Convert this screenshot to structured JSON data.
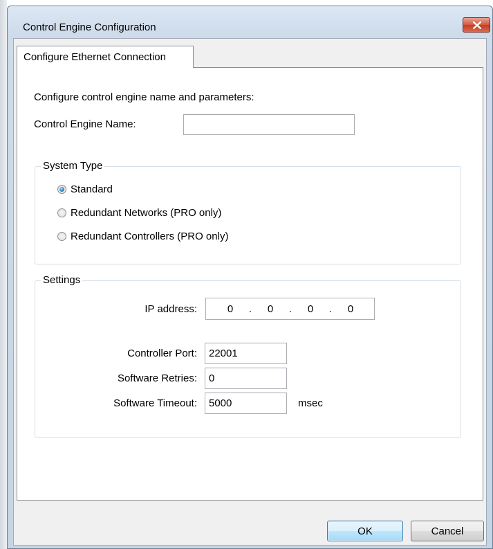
{
  "window": {
    "title": "Control Engine Configuration",
    "close_icon": "close-icon"
  },
  "tabs": [
    {
      "label": "Configure Ethernet Connection",
      "selected": true
    }
  ],
  "main": {
    "intro": "Configure control engine name and parameters:",
    "engine_name_label": "Control Engine Name:",
    "engine_name_value": "",
    "system_type": {
      "legend": "System Type",
      "options": [
        {
          "label": "Standard",
          "checked": true
        },
        {
          "label": "Redundant Networks (PRO only)",
          "checked": false
        },
        {
          "label": "Redundant Controllers (PRO only)",
          "checked": false
        }
      ]
    },
    "settings": {
      "legend": "Settings",
      "ip_label": "IP address:",
      "ip_octets": [
        "0",
        "0",
        "0",
        "0"
      ],
      "ip_separator": ".",
      "port_label": "Controller Port:",
      "port_value": "22001",
      "retries_label": "Software Retries:",
      "retries_value": "0",
      "timeout_label": "Software Timeout:",
      "timeout_value": "5000",
      "timeout_unit": "msec"
    }
  },
  "buttons": {
    "ok_label": "OK",
    "cancel_label": "Cancel"
  },
  "colors": {
    "accent": "#3c7fb1",
    "close_button": "#c33d24"
  }
}
